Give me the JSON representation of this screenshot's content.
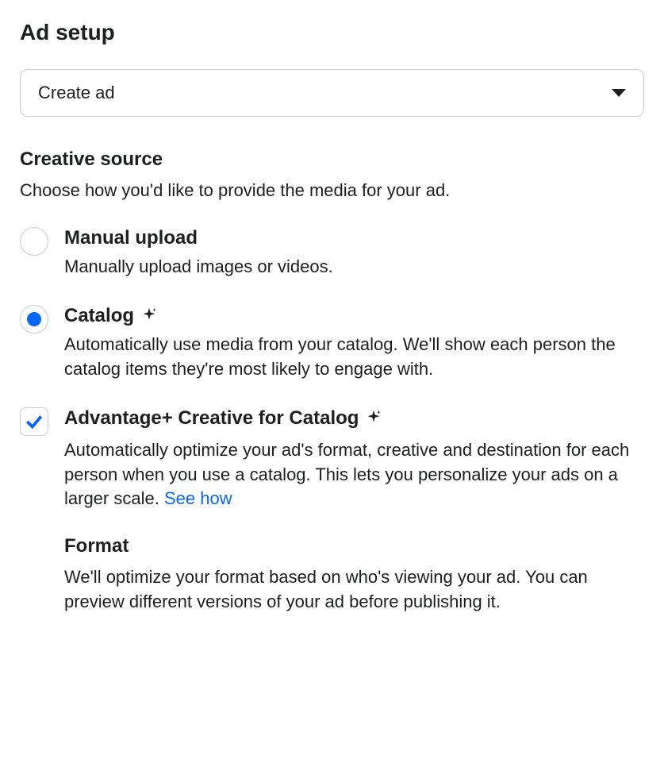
{
  "page": {
    "title": "Ad setup"
  },
  "dropdown": {
    "label": "Create ad"
  },
  "creative_source": {
    "title": "Creative source",
    "description": "Choose how you'd like to provide the media for your ad.",
    "options": {
      "manual": {
        "title": "Manual upload",
        "description": "Manually upload images or videos.",
        "selected": false
      },
      "catalog": {
        "title": "Catalog",
        "description": "Automatically use media from your catalog. We'll show each person the catalog items they're most likely to engage with.",
        "selected": true
      }
    }
  },
  "advantage": {
    "title": "Advantage+ Creative for Catalog",
    "description": "Automatically optimize your ad's format, creative and destination for each person when you use a catalog. This lets you personalize your ads on a larger scale.",
    "link": "See how",
    "checked": true
  },
  "format": {
    "title": "Format",
    "description": "We'll optimize your format based on who's viewing your ad. You can preview different versions of your ad before publishing it."
  }
}
